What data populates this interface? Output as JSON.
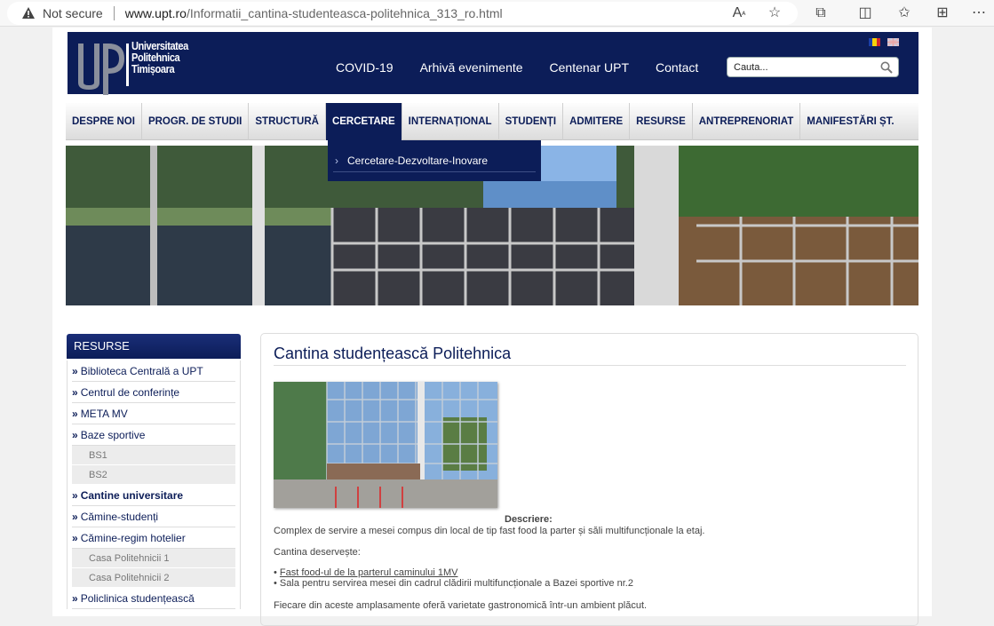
{
  "browser": {
    "security_label": "Not secure",
    "url_host": "www.upt.ro",
    "url_path": "/Informatii_cantina-studenteasca-politehnica_313_ro.html"
  },
  "header": {
    "logo_lines": [
      "Universitatea",
      "Politehnica",
      "Timișoara"
    ],
    "top_links": [
      "COVID-19",
      "Arhivă evenimente",
      "Centenar UPT",
      "Contact"
    ],
    "search_placeholder": "Cauta..."
  },
  "nav": {
    "items": [
      "DESPRE NOI",
      "PROGR. DE STUDII",
      "STRUCTURĂ",
      "CERCETARE",
      "INTERNAȚIONAL",
      "STUDENȚI",
      "ADMITERE",
      "RESURSE",
      "ANTREPRENORIAT",
      "MANIFESTĂRI ȘT."
    ],
    "active": "CERCETARE",
    "dropdown_item": "Cercetare-Dezvoltare-Inovare"
  },
  "sidebar": {
    "heading": "RESURSE",
    "items": [
      {
        "label": "Biblioteca Centrală a UPT",
        "type": "item"
      },
      {
        "label": "Centrul de conferințe",
        "type": "item"
      },
      {
        "label": "META MV",
        "type": "item"
      },
      {
        "label": "Baze sportive",
        "type": "item"
      },
      {
        "label": "BS1",
        "type": "sub"
      },
      {
        "label": "BS2",
        "type": "sub"
      },
      {
        "label": "Cantine universitare",
        "type": "item",
        "bold": true
      },
      {
        "label": "Cămine-studenți",
        "type": "item"
      },
      {
        "label": "Cămine-regim hotelier",
        "type": "item"
      },
      {
        "label": "Casa Politehnicii 1",
        "type": "sub"
      },
      {
        "label": "Casa Politehnicii 2",
        "type": "sub"
      },
      {
        "label": "Policlinica studențească",
        "type": "item"
      }
    ]
  },
  "content": {
    "title": "Cantina studențească Politehnica",
    "desc_label": "Descriere:",
    "desc_text": "Complex de servire a mesei compus din local de tip fast food la parter și săli multifuncționale la etaj.",
    "serves_label": "Cantina deservește:",
    "bullet1": "Fast food-ul de la parterul caminului 1MV",
    "bullet2": "Sala pentru servirea mesei din cadrul clădirii multifuncționale a Bazei sportive nr.2",
    "closing": "Fiecare din aceste amplasamente oferă varietate gastronomică într-un ambient plăcut."
  },
  "colors": {
    "brand_navy": "#0c1d58",
    "nav_bg": "#e8e8e8"
  }
}
